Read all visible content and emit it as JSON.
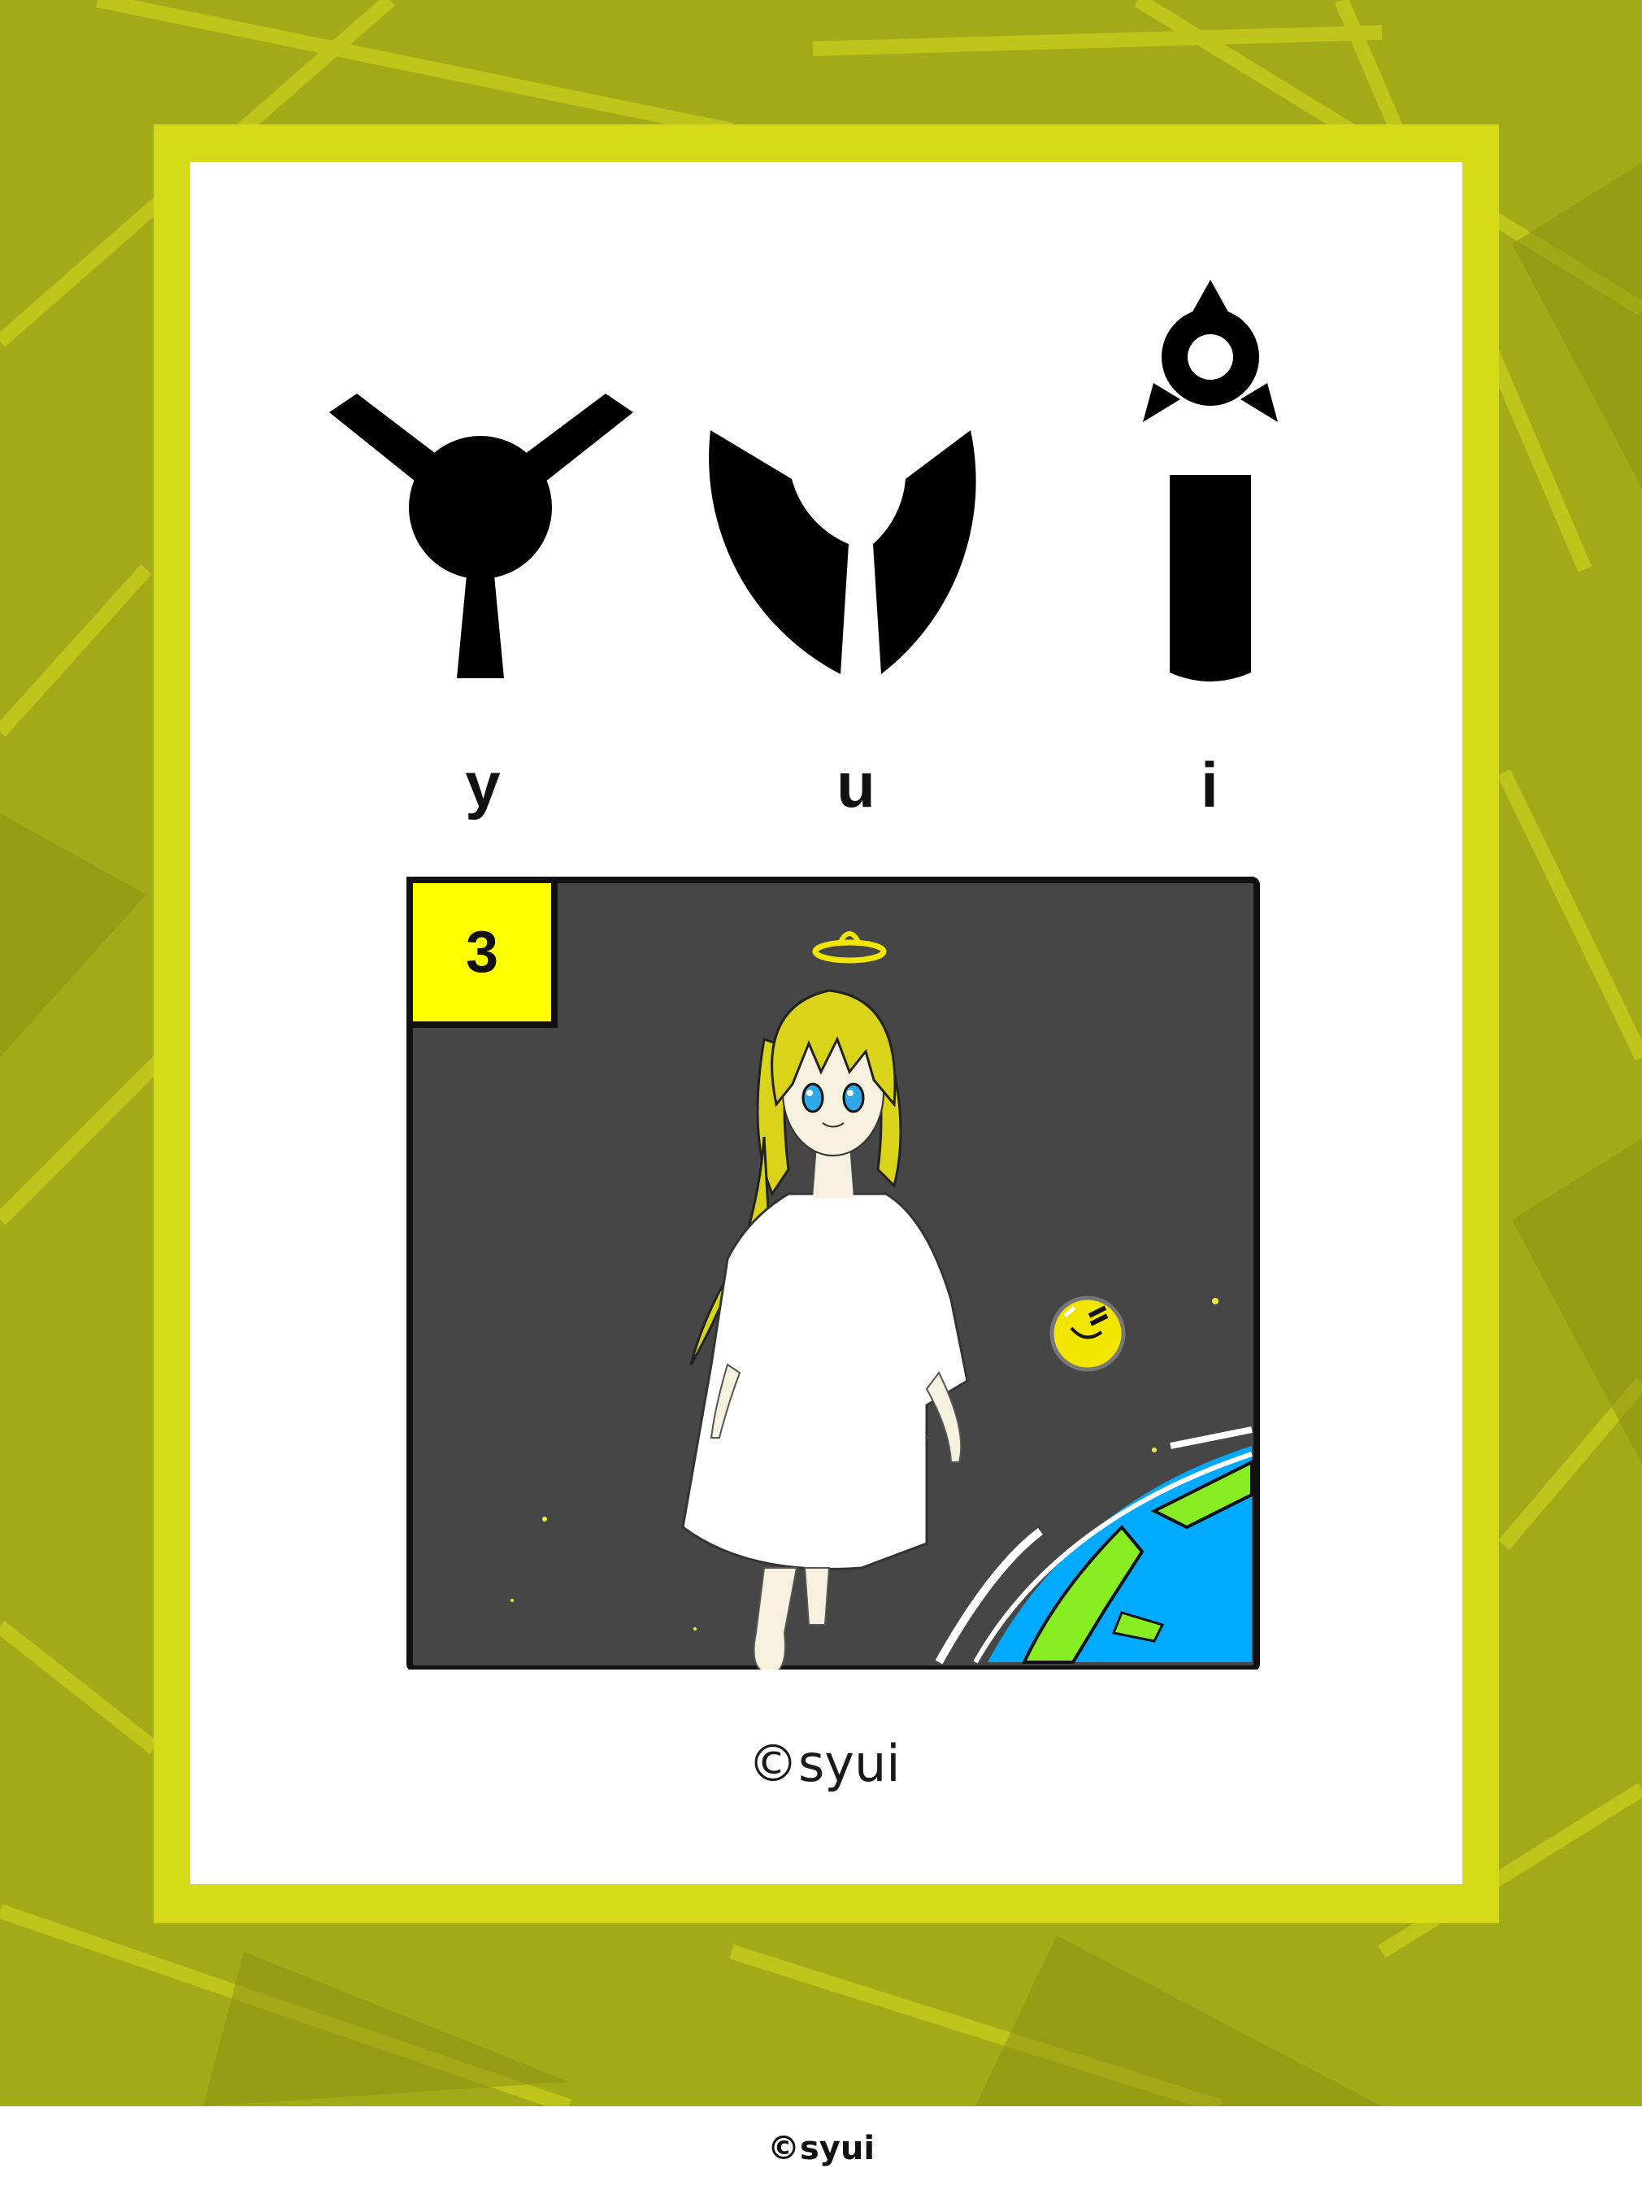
{
  "colors": {
    "background": "#a3aa18",
    "frame": "#d6da16",
    "card": "#ffffff",
    "badge": "#ffff00",
    "panel": "#464646",
    "hair": "#d9d41a",
    "eyes": "#2ea8e8",
    "ocean": "#00aaff",
    "land": "#88ee22"
  },
  "logo": {
    "letters": [
      "y",
      "u",
      "i"
    ]
  },
  "panel": {
    "number": "3"
  },
  "credit": "©syui",
  "footer": {
    "credit": "©syui"
  }
}
